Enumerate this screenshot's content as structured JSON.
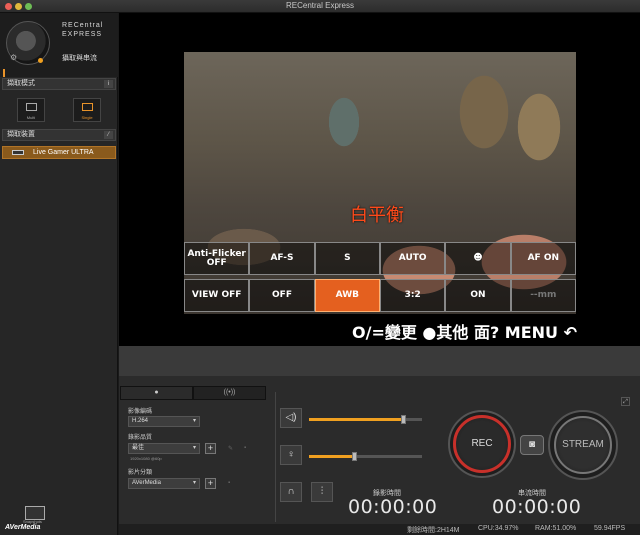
{
  "window": {
    "title": "RECentral Express"
  },
  "sidebar": {
    "brand_line1": "RECentral",
    "brand_line2": "EXPRESS",
    "mode_label": "攝取與串流",
    "capture_mode_header": "擷取模式",
    "capture_mode_info": "i",
    "modes": [
      {
        "label": "Multi",
        "selected": false
      },
      {
        "label": "Single",
        "selected": true
      }
    ],
    "capture_device_header": "擷取裝置",
    "device_name": "Live Gamer ULTRA",
    "snapshot_label": "Snapshots",
    "footer_brand": "AVerMedia",
    "accent_color": "#e8932a"
  },
  "preview": {
    "overlay_label": "白平衡",
    "menu_row1": [
      "Anti-Flicker OFF",
      "AF-S",
      "S",
      "AUTO",
      "",
      "AF ON"
    ],
    "menu_row2": [
      "VIEW OFF",
      "OFF",
      "AWB",
      "3:2",
      "ON",
      "--mm"
    ],
    "help_text": "O/=變更 ●其他 面? MENU ↶"
  },
  "controls": {
    "tabs": [
      "●",
      "((•))"
    ],
    "video_encoder_label": "影像編碼",
    "video_encoder_value": "H.264",
    "quality_label": "錄影品質",
    "quality_value": "最佳",
    "quality_info": "1920x1080 @60p",
    "category_label": "影片分類",
    "category_value": "AVerMedia",
    "speaker_volume": 0.83,
    "mic_volume": 0.4,
    "rec_time_label": "錄影時間",
    "rec_time": "00:00:00",
    "stream_time_label": "串流時間",
    "stream_time": "00:00:00",
    "rec_button": "REC",
    "stream_button": "STREAM"
  },
  "status": {
    "remaining": "剩餘時間:2H14M",
    "cpu": "CPU:34.97%",
    "ram": "RAM:51.00%",
    "fps": "59.94FPS"
  }
}
